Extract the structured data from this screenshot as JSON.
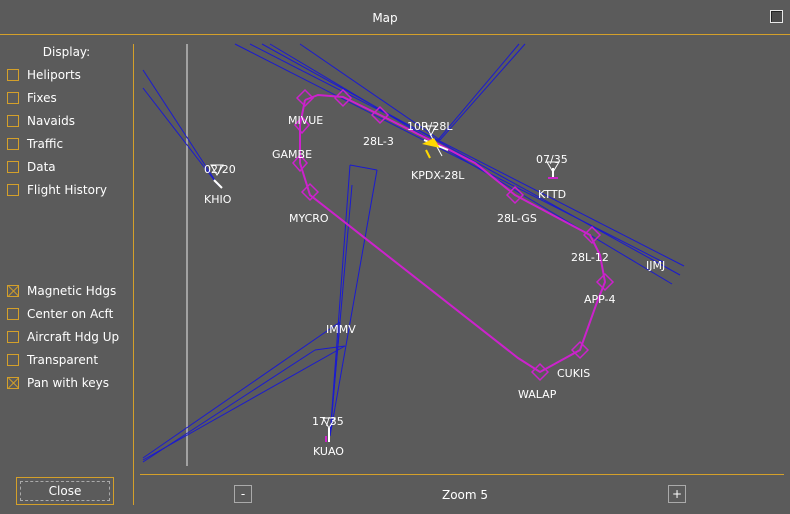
{
  "window": {
    "title": "Map"
  },
  "sidebar": {
    "display_label": "Display:",
    "options_top": [
      {
        "label": "Heliports",
        "checked": false
      },
      {
        "label": "Fixes",
        "checked": false
      },
      {
        "label": "Navaids",
        "checked": false
      },
      {
        "label": "Traffic",
        "checked": false
      },
      {
        "label": "Data",
        "checked": false
      },
      {
        "label": "Flight History",
        "checked": false
      }
    ],
    "options_bottom": [
      {
        "label": "Magnetic Hdgs",
        "checked": true
      },
      {
        "label": "Center on Acft",
        "checked": false
      },
      {
        "label": "Aircraft Hdg Up",
        "checked": false
      },
      {
        "label": "Transparent",
        "checked": false
      },
      {
        "label": "Pan with keys",
        "checked": true
      }
    ],
    "close_label": "Close"
  },
  "zoom": {
    "minus_label": "-",
    "plus_label": "+",
    "zoom_text": "Zoom 5"
  },
  "map": {
    "labels": {
      "mivue": "MIVUE",
      "gambe": "GAMBE",
      "mycro": "MYCRO",
      "l28_3": "28L-3",
      "rwy_10r28l": "10R/28L",
      "kpdx_28l": "KPDX-28L",
      "rwy_0735": "07/35",
      "kttd": "KTTD",
      "l28_gs": "28L-GS",
      "l28_12": "28L-12",
      "ijmj": "IJMJ",
      "app4": "APP-4",
      "cukis": "CUKIS",
      "walap": "WALAP",
      "immv": "IMMV",
      "rwy_1735": "17/35",
      "kuao": "KUAO",
      "rwy_0220": "02/20",
      "khio": "KHIO"
    },
    "colors": {
      "route": "#cc22cc",
      "navaid_lines": "#1a1ad0",
      "accent": "#d4a02a",
      "label": "#ffffff"
    }
  }
}
